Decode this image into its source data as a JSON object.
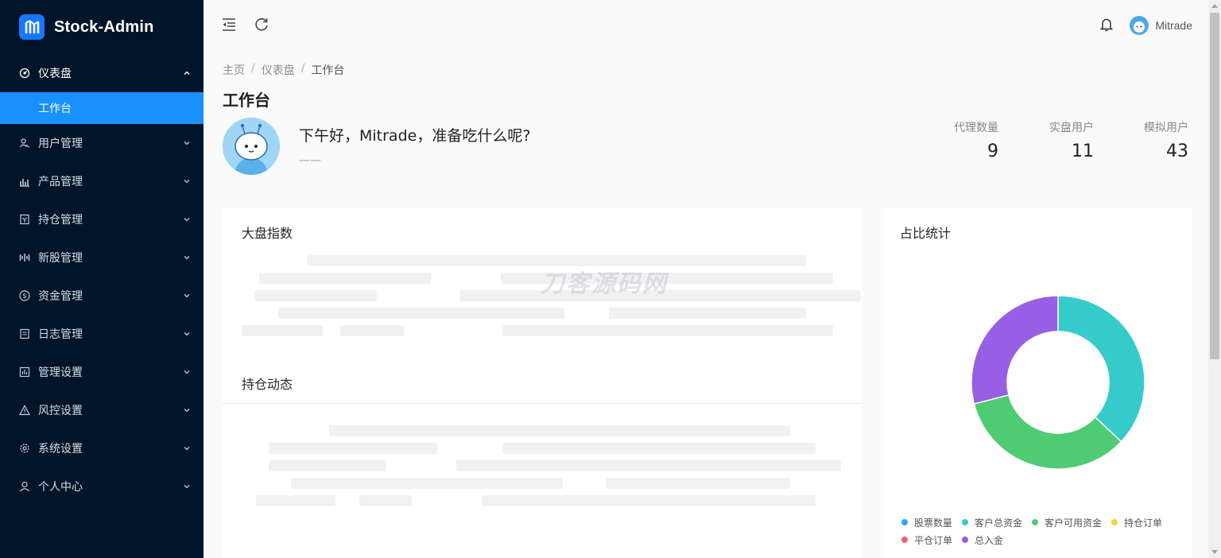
{
  "app": {
    "name": "Stock-Admin"
  },
  "sidebar": {
    "items": [
      {
        "label": "仪表盘",
        "icon": "dashboard-icon",
        "open": true
      },
      {
        "label": "用户管理",
        "icon": "users-icon"
      },
      {
        "label": "产品管理",
        "icon": "chart-icon"
      },
      {
        "label": "持仓管理",
        "icon": "position-icon"
      },
      {
        "label": "新股管理",
        "icon": "ipo-icon"
      },
      {
        "label": "资金管理",
        "icon": "dollar-icon"
      },
      {
        "label": "日志管理",
        "icon": "log-icon"
      },
      {
        "label": "管理设置",
        "icon": "admin-settings-icon"
      },
      {
        "label": "风控设置",
        "icon": "warning-icon"
      },
      {
        "label": "系统设置",
        "icon": "gear-icon"
      },
      {
        "label": "个人中心",
        "icon": "user-icon"
      }
    ],
    "sub_item": {
      "label": "工作台"
    }
  },
  "header": {
    "username": "Mitrade"
  },
  "breadcrumb": {
    "items": [
      "主页",
      "仪表盘",
      "工作台"
    ],
    "separator": "/"
  },
  "page": {
    "title": "工作台",
    "greeting": "下午好，Mitrade，准备吃什么呢?",
    "sub": "——"
  },
  "stats": [
    {
      "label": "代理数量",
      "value": "9"
    },
    {
      "label": "实盘用户",
      "value": "11"
    },
    {
      "label": "模拟用户",
      "value": "43"
    }
  ],
  "cards": {
    "index": {
      "title": "大盘指数"
    },
    "positions": {
      "title": "持仓动态"
    },
    "ratio": {
      "title": "占比统计"
    }
  },
  "watermark": "刀客源码网",
  "chart_data": {
    "type": "pie",
    "title": "占比统计",
    "legend_position": "bottom",
    "slices": [
      {
        "label": "股票数量",
        "value": 0,
        "color": "#3aa0f5"
      },
      {
        "label": "客户总资金",
        "value": 37,
        "color": "#36cbcb"
      },
      {
        "label": "客户可用资金",
        "value": 34,
        "color": "#4ecb73"
      },
      {
        "label": "持仓订单",
        "value": 0,
        "color": "#fad337"
      },
      {
        "label": "平仓订单",
        "value": 0,
        "color": "#f2637b"
      },
      {
        "label": "总入金",
        "value": 29,
        "color": "#975fe4"
      }
    ]
  }
}
